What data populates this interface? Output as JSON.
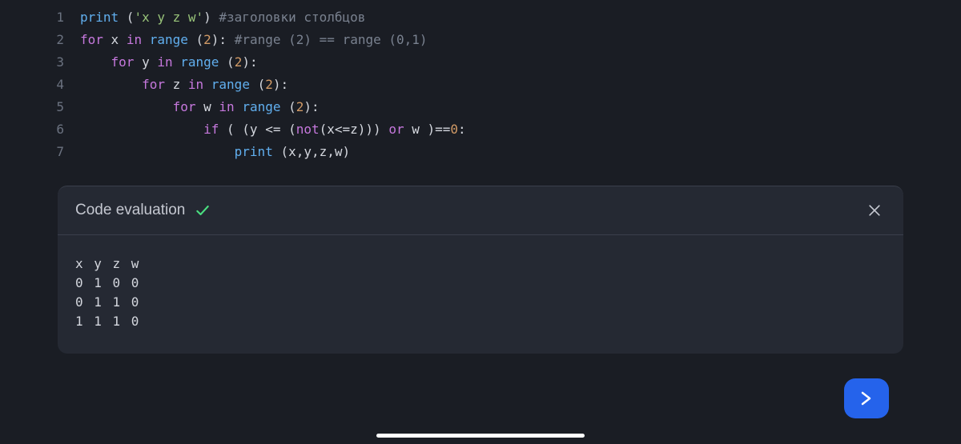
{
  "code": {
    "lines": [
      {
        "num": "1",
        "tokens": [
          {
            "t": "print",
            "c": "fn"
          },
          {
            "t": " (",
            "c": "op"
          },
          {
            "t": "'x y z w'",
            "c": "str"
          },
          {
            "t": ") ",
            "c": "op"
          },
          {
            "t": "#заголовки столбцов",
            "c": "com"
          }
        ]
      },
      {
        "num": "2",
        "tokens": [
          {
            "t": "for",
            "c": "kw"
          },
          {
            "t": " x ",
            "c": "var"
          },
          {
            "t": "in",
            "c": "kw"
          },
          {
            "t": " ",
            "c": "op"
          },
          {
            "t": "range",
            "c": "fn"
          },
          {
            "t": " (",
            "c": "op"
          },
          {
            "t": "2",
            "c": "num"
          },
          {
            "t": "): ",
            "c": "op"
          },
          {
            "t": "#range (2) == range (0,1)",
            "c": "com"
          }
        ]
      },
      {
        "num": "3",
        "tokens": [
          {
            "t": "    ",
            "c": "op"
          },
          {
            "t": "for",
            "c": "kw"
          },
          {
            "t": " y ",
            "c": "var"
          },
          {
            "t": "in",
            "c": "kw"
          },
          {
            "t": " ",
            "c": "op"
          },
          {
            "t": "range",
            "c": "fn"
          },
          {
            "t": " (",
            "c": "op"
          },
          {
            "t": "2",
            "c": "num"
          },
          {
            "t": "):",
            "c": "op"
          }
        ]
      },
      {
        "num": "4",
        "tokens": [
          {
            "t": "        ",
            "c": "op"
          },
          {
            "t": "for",
            "c": "kw"
          },
          {
            "t": " z ",
            "c": "var"
          },
          {
            "t": "in",
            "c": "kw"
          },
          {
            "t": " ",
            "c": "op"
          },
          {
            "t": "range",
            "c": "fn"
          },
          {
            "t": " (",
            "c": "op"
          },
          {
            "t": "2",
            "c": "num"
          },
          {
            "t": "):",
            "c": "op"
          }
        ]
      },
      {
        "num": "5",
        "tokens": [
          {
            "t": "            ",
            "c": "op"
          },
          {
            "t": "for",
            "c": "kw"
          },
          {
            "t": " w ",
            "c": "var"
          },
          {
            "t": "in",
            "c": "kw"
          },
          {
            "t": " ",
            "c": "op"
          },
          {
            "t": "range",
            "c": "fn"
          },
          {
            "t": " (",
            "c": "op"
          },
          {
            "t": "2",
            "c": "num"
          },
          {
            "t": "):",
            "c": "op"
          }
        ]
      },
      {
        "num": "6",
        "tokens": [
          {
            "t": "                ",
            "c": "op"
          },
          {
            "t": "if",
            "c": "kw"
          },
          {
            "t": " ( (y <= (",
            "c": "op"
          },
          {
            "t": "not",
            "c": "kw"
          },
          {
            "t": "(x<=z))) ",
            "c": "op"
          },
          {
            "t": "or",
            "c": "kw"
          },
          {
            "t": " w )==",
            "c": "op"
          },
          {
            "t": "0",
            "c": "num"
          },
          {
            "t": ":",
            "c": "op"
          }
        ]
      },
      {
        "num": "7",
        "tokens": [
          {
            "t": "                    ",
            "c": "op"
          },
          {
            "t": "print",
            "c": "fn"
          },
          {
            "t": " (x,y,z,w)",
            "c": "op"
          }
        ]
      }
    ]
  },
  "eval": {
    "title": "Code evaluation",
    "output": "x y z w\n0 1 0 0\n0 1 1 0\n1 1 1 0"
  }
}
